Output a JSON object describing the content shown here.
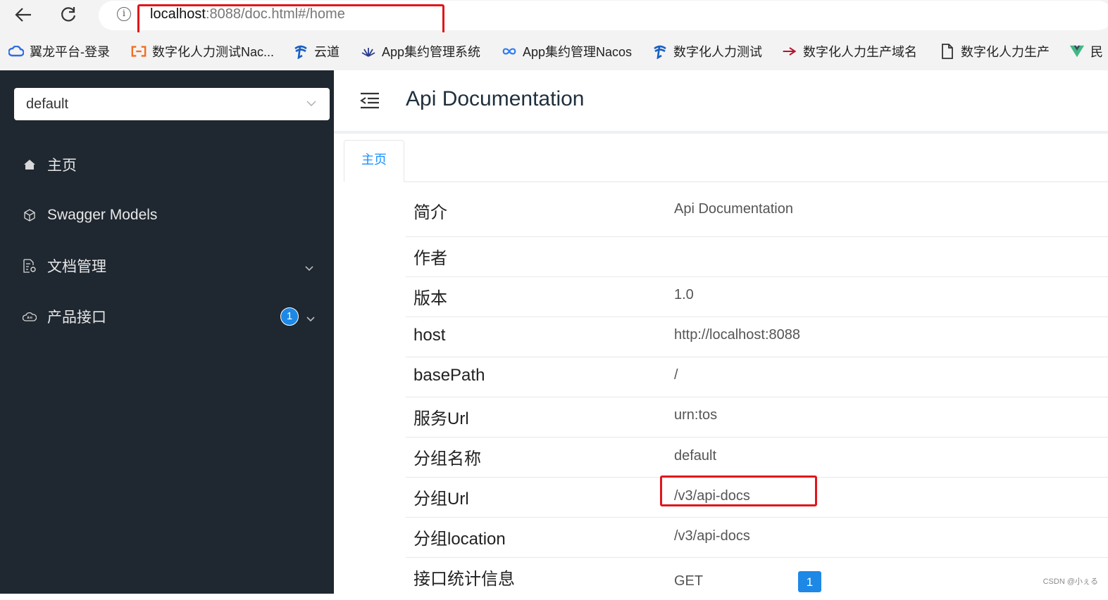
{
  "browser": {
    "url_host": "localhost",
    "url_rest": ":8088/doc.html#/home",
    "bookmarks": [
      {
        "label": "翼龙平台-登录",
        "icon": "cloud-icon"
      },
      {
        "label": "数字化人力测试Nac...",
        "icon": "bracket-logo-icon"
      },
      {
        "label": "云道",
        "icon": "telecom-logo-icon"
      },
      {
        "label": "App集约管理系统",
        "icon": "lotus-icon"
      },
      {
        "label": "App集约管理Nacos",
        "icon": "infinity-icon"
      },
      {
        "label": "数字化人力测试",
        "icon": "telecom-logo-icon"
      },
      {
        "label": "数字化人力生产域名",
        "icon": "arrow-logo-icon"
      },
      {
        "label": "数字化人力生产",
        "icon": "document-icon"
      },
      {
        "label": "民",
        "icon": "vue-logo-icon"
      }
    ]
  },
  "sidebar": {
    "group_select": "default",
    "items": [
      {
        "label": "主页",
        "icon": "home-icon"
      },
      {
        "label": "Swagger Models",
        "icon": "cube-icon"
      },
      {
        "label": "文档管理",
        "icon": "doc-settings-icon"
      },
      {
        "label": "产品接口",
        "icon": "cloud-api-icon",
        "badge": "1"
      }
    ]
  },
  "header": {
    "title": "Api Documentation"
  },
  "tabs": [
    {
      "label": "主页"
    }
  ],
  "info": [
    {
      "key": "简介",
      "value": "Api Documentation"
    },
    {
      "key": "作者",
      "value": ""
    },
    {
      "key": "版本",
      "value": "1.0"
    },
    {
      "key": "host",
      "value": "http://localhost:8088"
    },
    {
      "key": "basePath",
      "value": "/"
    },
    {
      "key": "服务Url",
      "value": "urn:tos"
    },
    {
      "key": "分组名称",
      "value": "default"
    },
    {
      "key": "分组Url",
      "value": "/v3/api-docs"
    },
    {
      "key": "分组location",
      "value": "/v3/api-docs"
    },
    {
      "key": "接口统计信息",
      "value": "GET",
      "count": "1"
    }
  ],
  "watermark": "CSDN @小ぇる",
  "colors": {
    "sidebar_bg": "#1f2730",
    "accent": "#1890ff",
    "highlight": "#e0161b"
  }
}
